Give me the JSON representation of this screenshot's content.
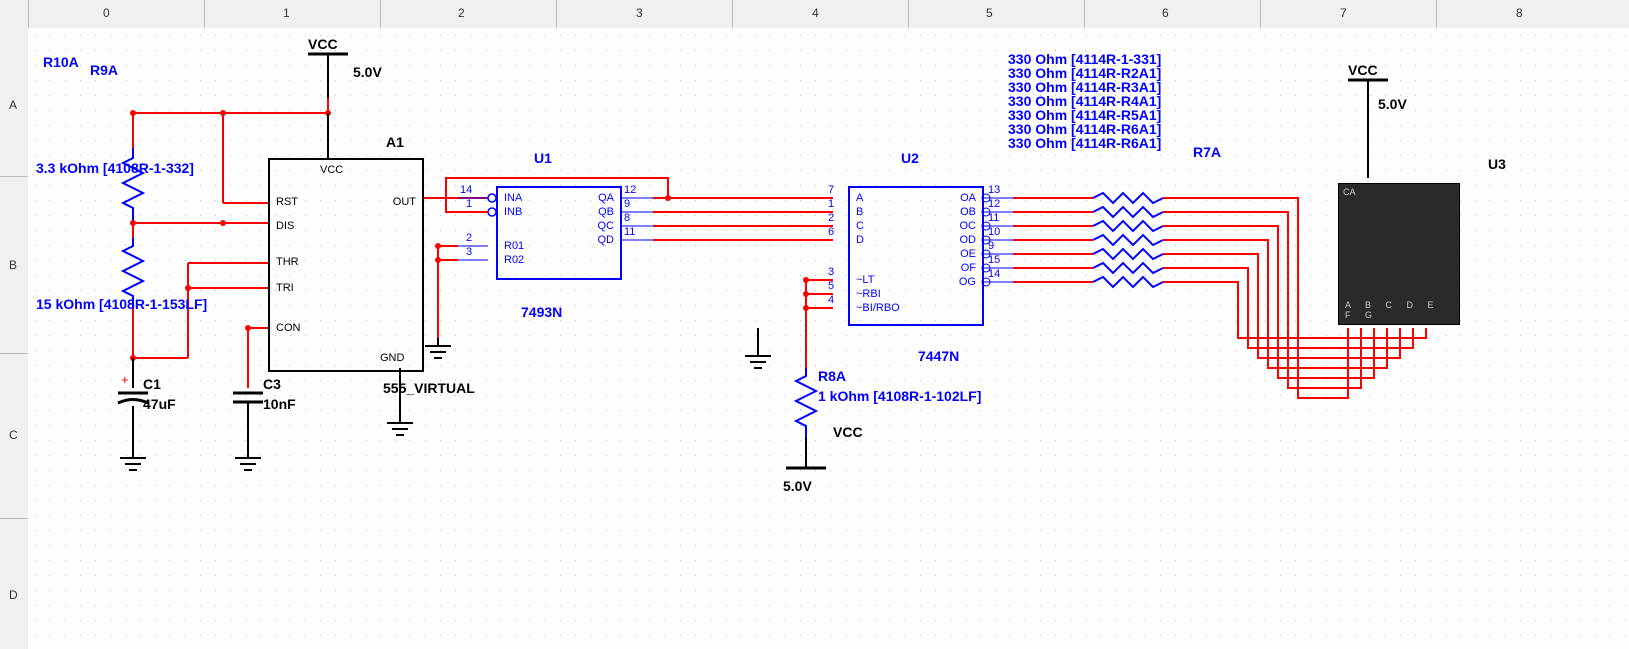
{
  "ruler": {
    "cols": [
      "0",
      "1",
      "2",
      "3",
      "4",
      "5",
      "6",
      "7",
      "8"
    ],
    "rows": [
      "A",
      "B",
      "C",
      "D"
    ]
  },
  "power": {
    "vcc": "VCC",
    "volts": "5.0V"
  },
  "resistors": {
    "r10a": "R10A",
    "r9a": "R9A",
    "r10a_val": "3.3 kOhm  [4108R-1-332]",
    "r9a_val": "15 kOhm  [4108R-1-153LF]",
    "r8a": "R8A",
    "r8a_val": "1 kOhm  [4108R-1-102LF]",
    "r_array_label": "R7A",
    "r_array_lines": [
      "330 Ohm  [4114R-1-331]",
      "330 Ohm  [4114R-R2A1]",
      "330 Ohm  [4114R-R3A1]",
      "330 Ohm  [4114R-R4A1]",
      "330 Ohm  [4114R-R5A1]",
      "330 Ohm  [4114R-R6A1]",
      "330 Ohm  [4114R-R6A1]"
    ]
  },
  "caps": {
    "c1": "C1",
    "c1_val": "47uF",
    "c3": "C3",
    "c3_val": "10nF"
  },
  "ic555": {
    "ref": "A1",
    "name": "555_VIRTUAL",
    "pins_left": [
      "VCC",
      "RST",
      "DIS",
      "THR",
      "TRI",
      "CON",
      "GND"
    ],
    "pins_out": "OUT"
  },
  "u1": {
    "ref": "U1",
    "name": "7493N",
    "left": [
      "INA",
      "INB",
      "R01",
      "R02"
    ],
    "right": [
      "QA",
      "QB",
      "QC",
      "QD"
    ],
    "nums_left": [
      "14",
      "1",
      "2",
      "3"
    ],
    "nums_right": [
      "12",
      "9",
      "8",
      "11"
    ]
  },
  "u2": {
    "ref": "U2",
    "name": "7447N",
    "left": [
      "A",
      "B",
      "C",
      "D",
      "~LT",
      "~RBI",
      "~BI/RBO"
    ],
    "right": [
      "OA",
      "OB",
      "OC",
      "OD",
      "OE",
      "OF",
      "OG"
    ],
    "nums_left": [
      "7",
      "1",
      "2",
      "6",
      "3",
      "5",
      "4"
    ],
    "nums_right": [
      "13",
      "12",
      "11",
      "10",
      "9",
      "15",
      "14"
    ]
  },
  "u3": {
    "ref": "U3",
    "type": "CA",
    "pins": "A B C D E F G"
  }
}
